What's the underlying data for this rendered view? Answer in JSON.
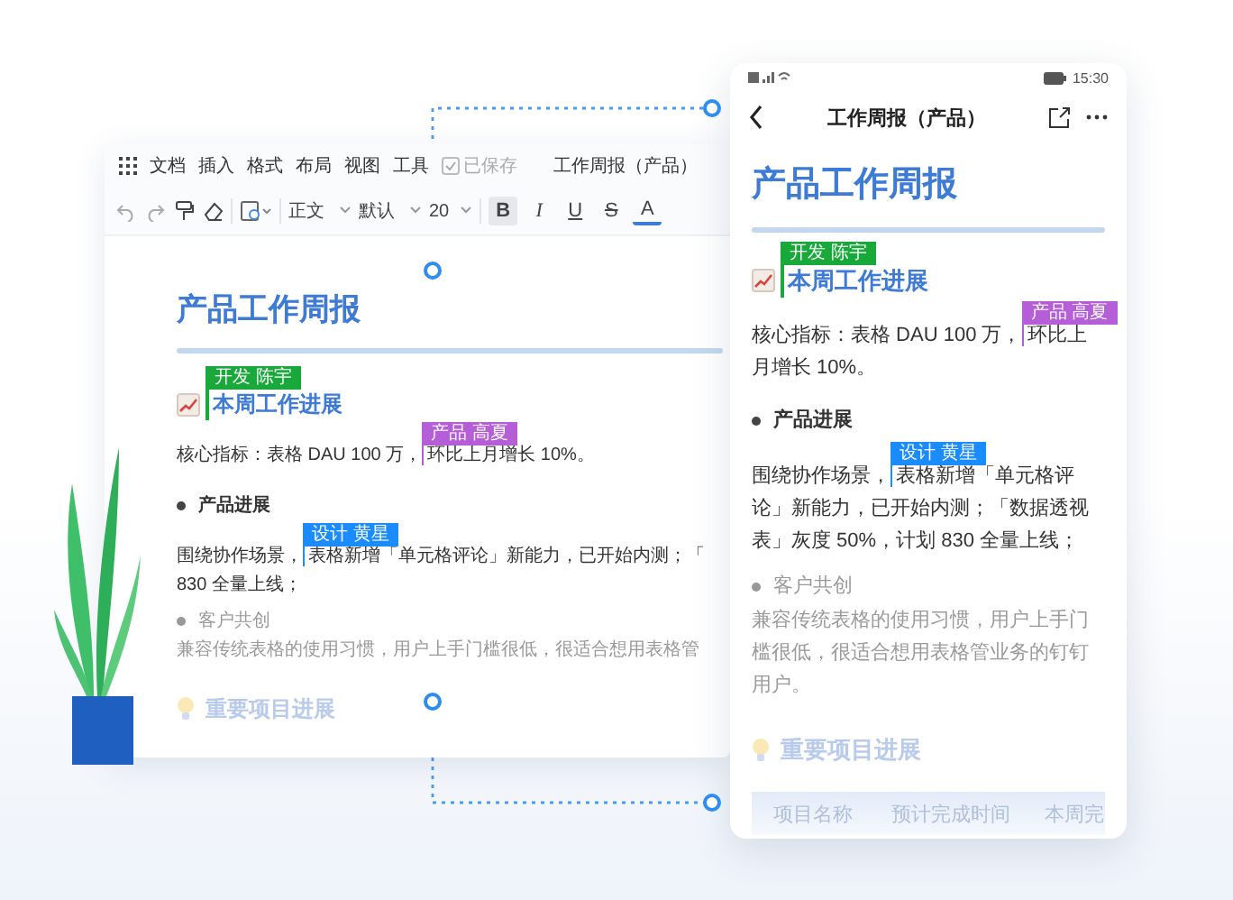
{
  "desktop": {
    "menu": [
      {
        "label": "文档"
      },
      {
        "label": "插入"
      },
      {
        "label": "格式"
      },
      {
        "label": "布局"
      },
      {
        "label": "视图"
      },
      {
        "label": "工具"
      }
    ],
    "saved": {
      "label": "已保存",
      "checked": true
    },
    "title": "工作周报（产品）",
    "dropdowns": [
      {
        "kind": "style",
        "value": "正文"
      },
      {
        "kind": "font",
        "value": "默认"
      },
      {
        "kind": "size",
        "value": "20"
      }
    ],
    "format_buttons": [
      {
        "kind": "bold",
        "label": "B",
        "selected": true
      },
      {
        "kind": "italic",
        "label": "I",
        "selected": false
      },
      {
        "kind": "underline",
        "label": "U",
        "selected": false
      },
      {
        "kind": "strike",
        "label": "S",
        "selected": false
      },
      {
        "kind": "color",
        "label": "A",
        "selected": false
      }
    ],
    "blocks": [
      {
        "kind": "title",
        "text": "产品工作周报"
      },
      {
        "kind": "heading",
        "text": "本周工作进展",
        "tag": {
          "text": "开发 陈宇",
          "color": "#19a83a"
        }
      },
      {
        "kind": "para",
        "before": "核心指标：表格 DAU 100 万，",
        "after": "环比上月增长 10%。",
        "tag": {
          "text": "产品 高夏",
          "color": "#b65ed8"
        }
      },
      {
        "kind": "bullet",
        "text": "产品进展",
        "muted": false
      },
      {
        "kind": "para",
        "before": "围绕协作场景，",
        "after": "表格新增「单元格评论」新能力，已开始内测；「",
        "tag": {
          "text": "设计 黄星",
          "color": "#1a8cff"
        }
      },
      {
        "kind": "para",
        "text": "830 全量上线；"
      },
      {
        "kind": "bullet",
        "text": "客户共创",
        "muted": true
      },
      {
        "kind": "para",
        "text": "兼容传统表格的使用习惯，用户上手门槛很低，很适合想用表格管",
        "muted": true
      },
      {
        "kind": "faded_heading",
        "text": "重要项目进展"
      }
    ]
  },
  "phone": {
    "time": "15:30",
    "title": "工作周报（产品）",
    "blocks": [
      {
        "kind": "title",
        "text": "产品工作周报"
      },
      {
        "kind": "heading",
        "text": "本周工作进展",
        "tag": {
          "text": "开发 陈宇",
          "color": "#19a83a"
        }
      },
      {
        "kind": "para",
        "before": "核心指标：表格 DAU 100 万，",
        "after": "环比上月增长 10%。",
        "tag": {
          "text": "产品 高夏",
          "color": "#b65ed8"
        }
      },
      {
        "kind": "bullet",
        "text": "产品进展",
        "muted": false
      },
      {
        "kind": "para",
        "before": "围绕协作场景，",
        "after": "表格新增「单元格评论」新能力，已开始内测；「数据透视表」灰度 50%，计划 830 全量上线；",
        "tag": {
          "text": "设计 黄星",
          "color": "#1a8cff"
        }
      },
      {
        "kind": "bullet",
        "text": "客户共创",
        "muted": true
      },
      {
        "kind": "para",
        "text": "兼容传统表格的使用习惯，用户上手门槛很低，很适合想用表格管业务的钉钉用户。",
        "muted": true
      },
      {
        "kind": "faded_heading",
        "text": "重要项目进展"
      },
      {
        "kind": "table",
        "columns": [
          "项目名称",
          "预计完成时间",
          "本周完"
        ]
      }
    ]
  }
}
